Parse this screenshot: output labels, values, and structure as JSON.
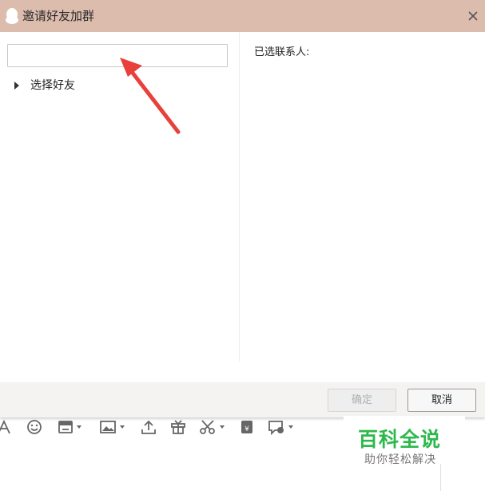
{
  "window": {
    "title": "邀请好友加群"
  },
  "search": {
    "value": "",
    "placeholder": ""
  },
  "friends_tree": {
    "label": "选择好友"
  },
  "selected_panel": {
    "label": "已选联系人:"
  },
  "buttons": {
    "ok_label": "确定",
    "cancel_label": "取消"
  },
  "toolbar": {
    "icons": [
      "font-icon",
      "emoji-icon",
      "screenshot-icon",
      "image-icon",
      "upload-icon",
      "gift-icon",
      "scissors-icon",
      "red-packet-icon",
      "chat-settings-icon"
    ]
  },
  "watermark": {
    "main": "百科全说",
    "sub": "助你轻松解决"
  },
  "colors": {
    "titlebar": "#dcbcad",
    "arrow": "#e8413b",
    "watermark_green": "#2db84b"
  }
}
